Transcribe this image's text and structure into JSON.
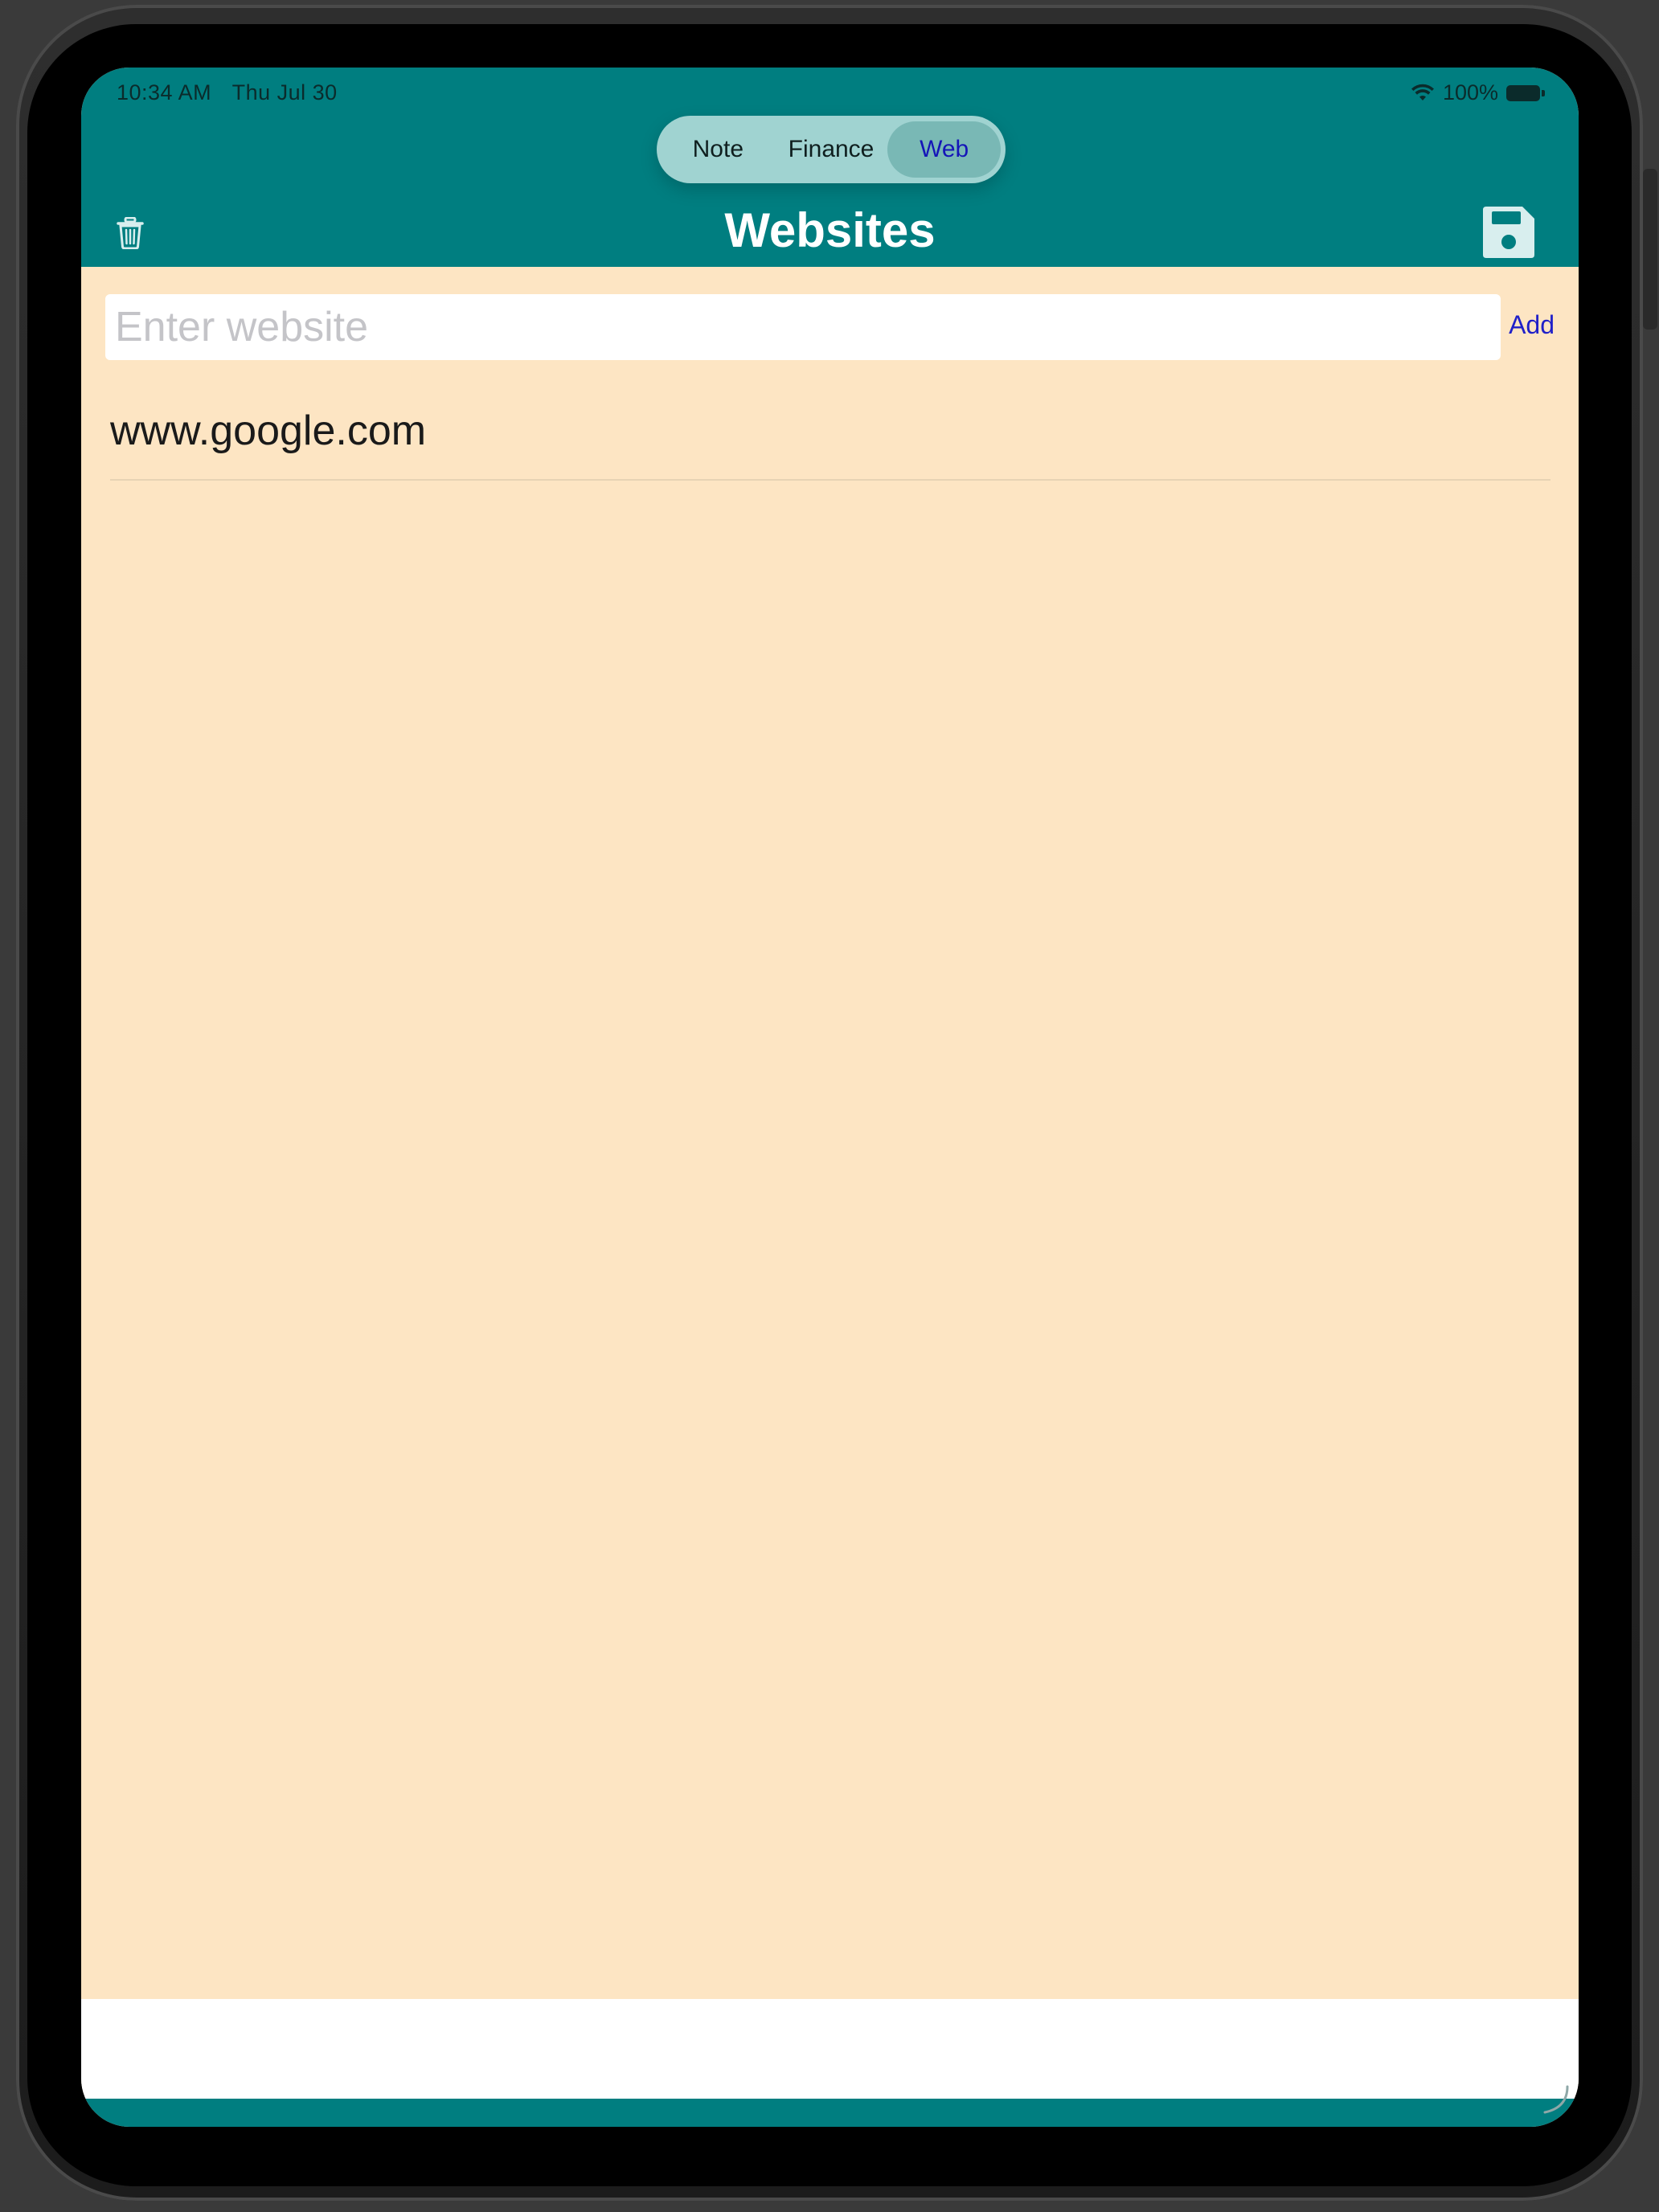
{
  "status_bar": {
    "time": "10:34 AM",
    "date": "Thu Jul 30",
    "battery": "100%"
  },
  "segments": [
    {
      "label": "Note",
      "selected": false
    },
    {
      "label": "Finance",
      "selected": false
    },
    {
      "label": "Web",
      "selected": true
    }
  ],
  "nav": {
    "title": "Websites",
    "left_icon": "trash-icon",
    "right_icon": "save-icon"
  },
  "website_input": {
    "value": "",
    "placeholder": "Enter website"
  },
  "add_button": {
    "label": "Add"
  },
  "websites": [
    {
      "label": "www.google.com"
    }
  ],
  "colors": {
    "nav_background": "#007E80",
    "content_background": "#FDE5C3",
    "segment_background": "#A0D3D1",
    "segment_selected": "#79B8B5",
    "selected_text": "#1515B8",
    "link": "#2020C8"
  }
}
